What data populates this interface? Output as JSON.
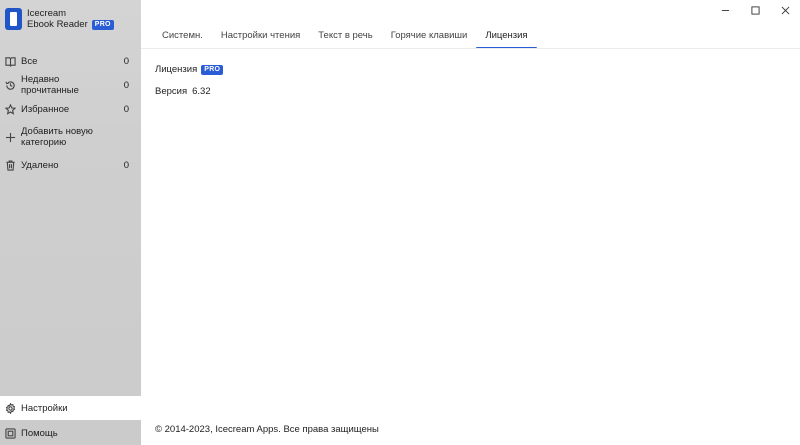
{
  "brand": {
    "line1": "Icecream",
    "line2": "Ebook Reader",
    "badge": "PRO"
  },
  "sidebar": {
    "items": [
      {
        "label": "Все",
        "count": "0",
        "icon": "book-icon"
      },
      {
        "label": "Недавно прочитанные",
        "count": "0",
        "icon": "history-icon"
      },
      {
        "label": "Избранное",
        "count": "0",
        "icon": "star-icon"
      },
      {
        "label": "Добавить новую категорию",
        "count": "",
        "icon": "plus-icon"
      },
      {
        "label": "Удалено",
        "count": "0",
        "icon": "trash-icon"
      }
    ],
    "bottom": [
      {
        "label": "Настройки",
        "icon": "gear-icon"
      },
      {
        "label": "Помощь",
        "icon": "help-icon"
      }
    ]
  },
  "tabs": [
    "Системн.",
    "Настройки чтения",
    "Текст в речь",
    "Горячие клавиши",
    "Лицензия"
  ],
  "active_tab": "Лицензия",
  "license": {
    "label": "Лицензия",
    "badge": "PRO",
    "version_label": "Версия",
    "version_value": "6.32"
  },
  "footer": "© 2014-2023, Icecream Apps. Все права защищены",
  "colors": {
    "accent": "#2a5cd6",
    "sidebar_bg": "#cfcfcf",
    "active_bg": "#ffffff"
  }
}
